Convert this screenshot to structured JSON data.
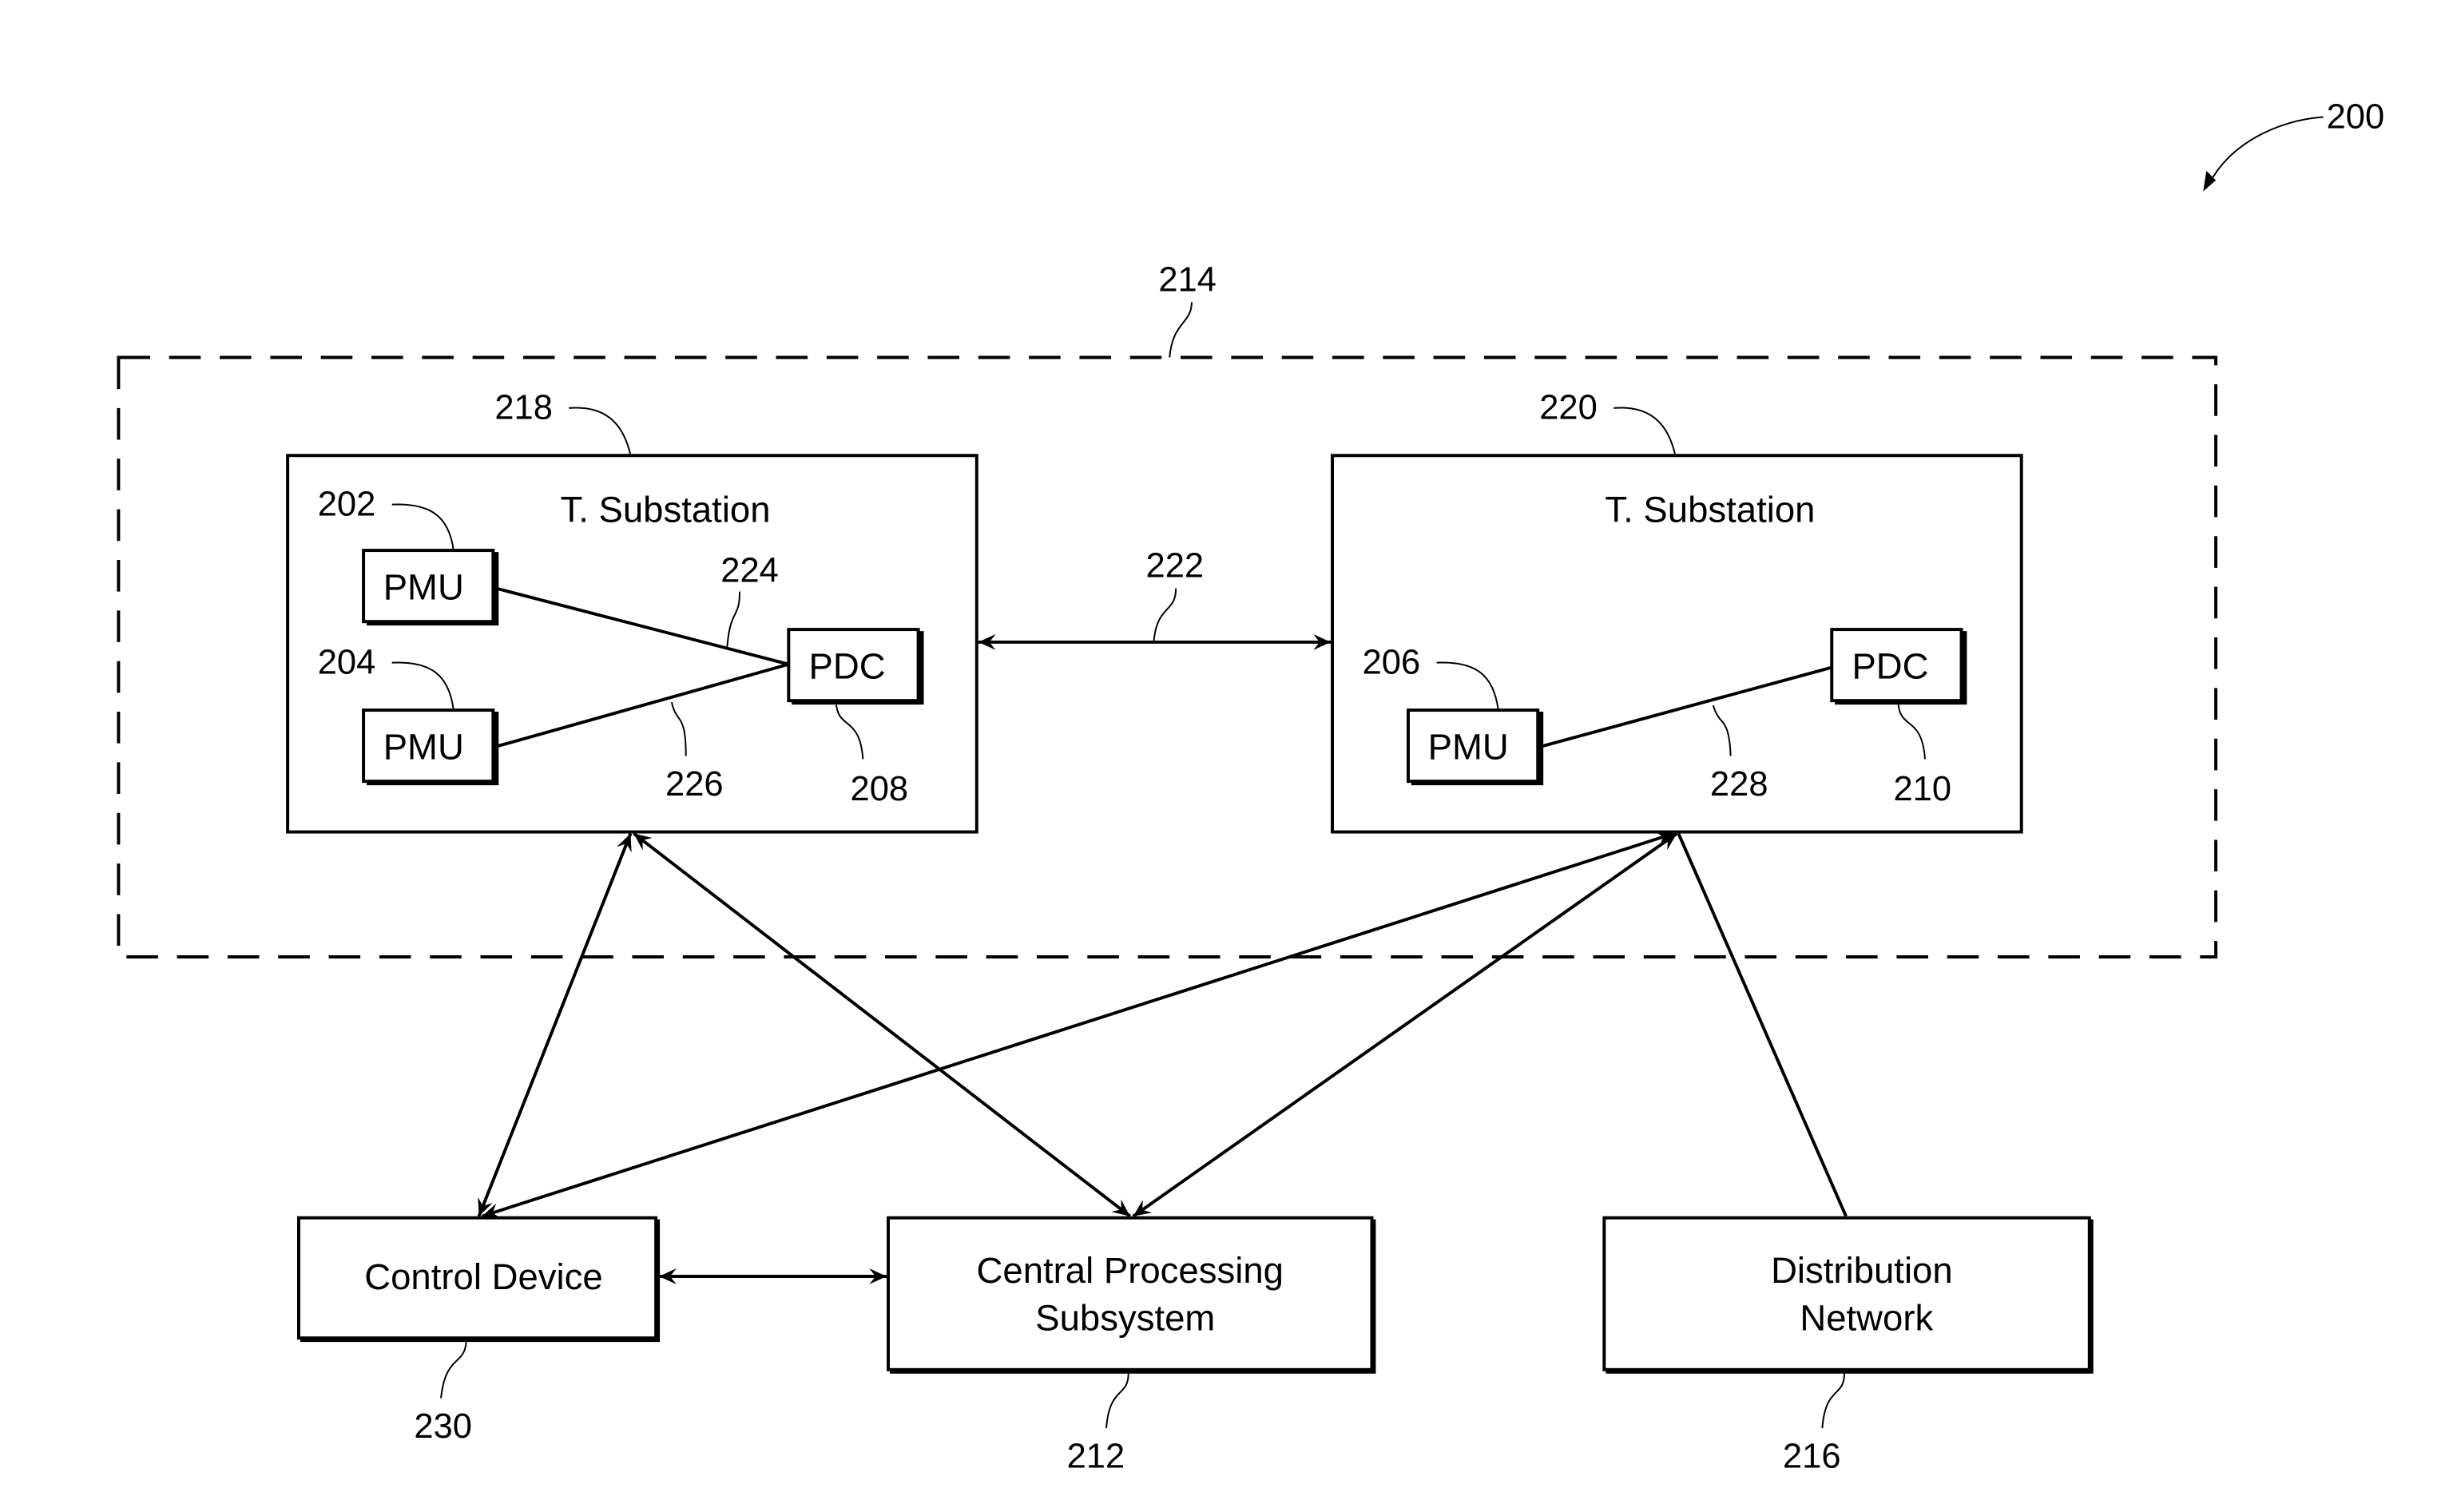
{
  "figure": {
    "reference": "200",
    "region": {
      "ref": "214"
    },
    "substations": [
      {
        "ref": "218",
        "title": "T. Substation",
        "pmus": [
          {
            "ref": "202",
            "label": "PMU"
          },
          {
            "ref": "204",
            "label": "PMU"
          }
        ],
        "pdc": {
          "ref": "208",
          "label": "PDC"
        },
        "links": [
          {
            "ref": "224"
          },
          {
            "ref": "226"
          }
        ]
      },
      {
        "ref": "220",
        "title": "T. Substation",
        "pmus": [
          {
            "ref": "206",
            "label": "PMU"
          }
        ],
        "pdc": {
          "ref": "210",
          "label": "PDC"
        },
        "links": [
          {
            "ref": "228"
          }
        ]
      }
    ],
    "inter_substation_link": {
      "ref": "222"
    },
    "control_device": {
      "ref": "230",
      "label": "Control Device"
    },
    "central_processing": {
      "ref": "212",
      "label_line1": "Central Processing",
      "label_line2": "Subsystem"
    },
    "distribution_network": {
      "ref": "216",
      "label_line1": "Distribution",
      "label_line2": "Network"
    }
  }
}
